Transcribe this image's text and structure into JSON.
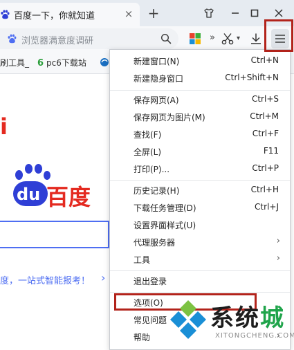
{
  "tab": {
    "title": "百度一下，你就知道",
    "close": "×",
    "new_tab": "+"
  },
  "toolbar": {
    "address_placeholder": "浏览器满意度调研",
    "more": "»",
    "cut_dropdown": "▾"
  },
  "bookmarks": [
    {
      "label": "刷工具_"
    },
    {
      "label": "pc6下载站"
    }
  ],
  "page": {
    "logo_left": "i",
    "logo_du": "du",
    "logo_text": "百度",
    "promo": "度，一站式智能报考！",
    "promo_arrow": "›"
  },
  "menu": {
    "items": [
      {
        "label": "新建窗口(N)",
        "shortcut": "Ctrl+N"
      },
      {
        "label": "新建隐身窗口",
        "shortcut": "Ctrl+Shift+N"
      },
      {
        "label": "保存网页(A)",
        "shortcut": "Ctrl+S"
      },
      {
        "label": "保存网页为图片(M)",
        "shortcut": "Ctrl+M"
      },
      {
        "label": "查找(F)",
        "shortcut": "Ctrl+F"
      },
      {
        "label": "全屏(L)",
        "shortcut": "F11"
      },
      {
        "label": "打印(P)...",
        "shortcut": "Ctrl+P"
      },
      {
        "label": "历史记录(H)",
        "shortcut": "Ctrl+H"
      },
      {
        "label": "下载任务管理(D)",
        "shortcut": "Ctrl+J"
      },
      {
        "label": "设置界面样式(U)",
        "shortcut": ""
      },
      {
        "label": "代理服务器",
        "shortcut": "",
        "arrow": "›"
      },
      {
        "label": "工具",
        "shortcut": "",
        "arrow": "›"
      },
      {
        "label": "退出登录",
        "shortcut": ""
      },
      {
        "label": "选项(O)",
        "shortcut": ""
      },
      {
        "label": "常见问题",
        "shortcut": ""
      },
      {
        "label": "帮助",
        "shortcut": "",
        "arrow": "›"
      }
    ]
  },
  "watermark": {
    "name_a": "系统",
    "name_b": "城",
    "domain": "XITONGCHENG.COM"
  },
  "colors": {
    "highlight_box": "#b2231b",
    "baidu_red": "#e42a20",
    "baidu_blue": "#2f3fd6",
    "link_blue": "#4e6ef2",
    "watermark_green": "#1fa44a",
    "watermark_blue": "#1a8fd6"
  },
  "icons": [
    "baidu-paw-icon",
    "close-icon",
    "plus-icon",
    "shirt-skin-icon",
    "minimize-icon",
    "maximize-icon",
    "close-window-icon",
    "survey-paw-icon",
    "search-icon",
    "apps-grid-icon",
    "scissors-icon",
    "download-arrow-icon",
    "hamburger-menu-icon",
    "pc6-icon",
    "browser-bookmark-icon",
    "submenu-arrow-icon"
  ]
}
